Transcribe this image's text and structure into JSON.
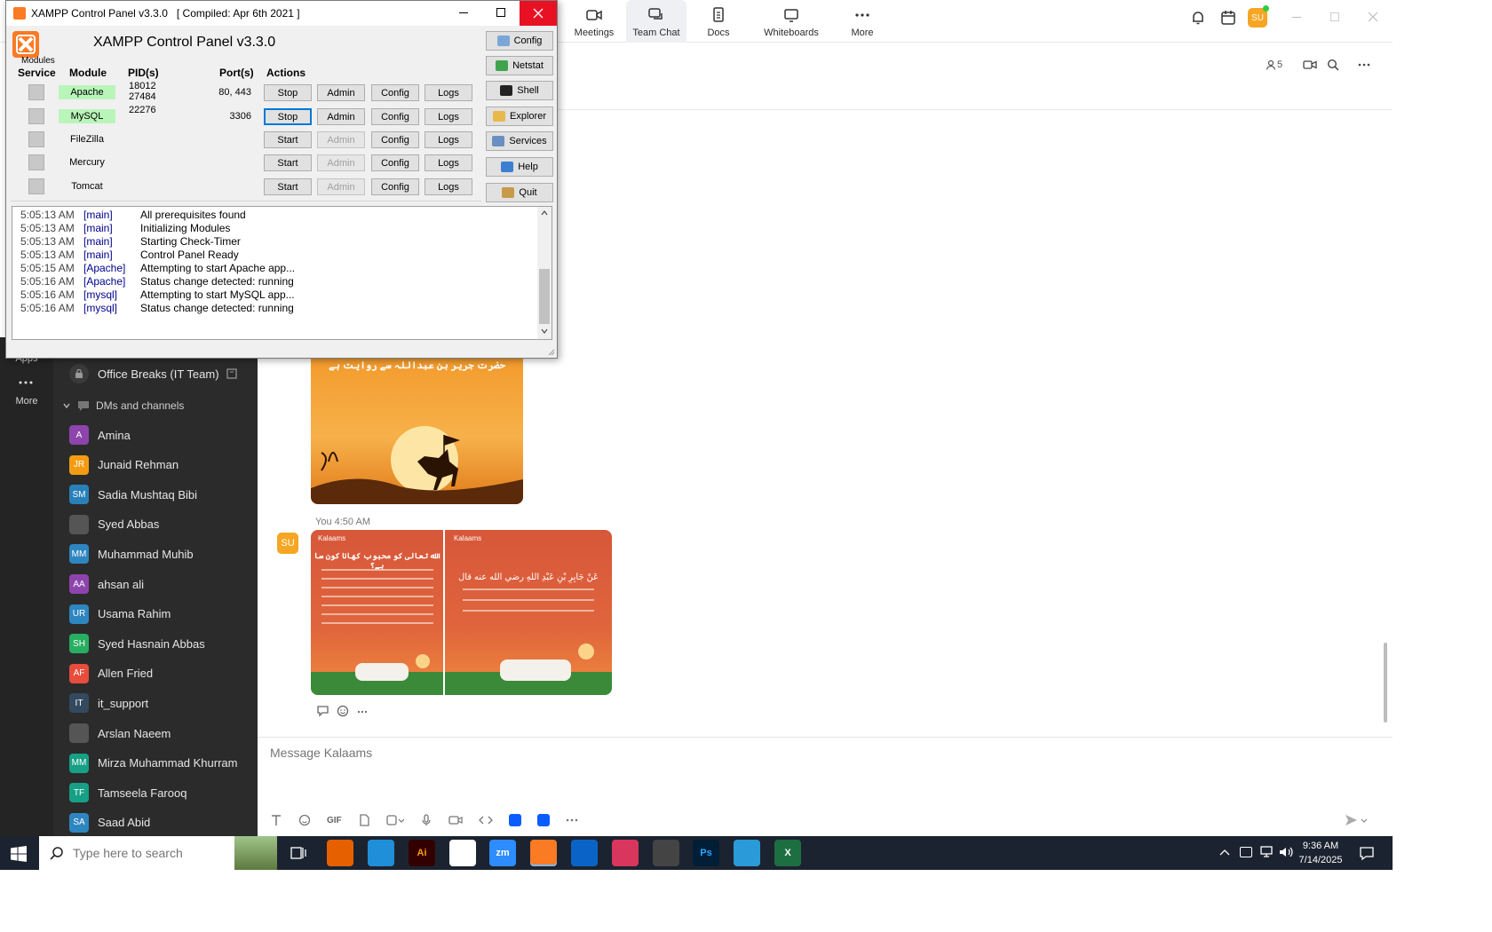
{
  "zoom": {
    "tabs": [
      {
        "label": "Meetings",
        "icon": "video-camera-icon"
      },
      {
        "label": "Team Chat",
        "icon": "chat-bubble-icon",
        "active": true
      },
      {
        "label": "Docs",
        "icon": "document-icon"
      },
      {
        "label": "Whiteboards",
        "icon": "whiteboard-icon"
      },
      {
        "label": "More",
        "icon": "more-dots-icon"
      }
    ],
    "user_initials": "SU",
    "header_member_count": "5",
    "rail": {
      "apps_label": "Apps",
      "more_label": "More"
    },
    "sidebar": {
      "channel_office": "Office Breaks (IT Team)",
      "section_dms": "DMs and channels",
      "contacts": [
        {
          "name": "Amina",
          "initials": "A",
          "color": "#8e44ad"
        },
        {
          "name": "Junaid Rehman",
          "initials": "JR",
          "color": "#f39c12"
        },
        {
          "name": "Sadia Mushtaq Bibi",
          "initials": "SM",
          "color": "#2980b9"
        },
        {
          "name": "Syed Abbas",
          "initials": "",
          "color": "#555"
        },
        {
          "name": "Muhammad Muhib",
          "initials": "MM",
          "color": "#2e86c1"
        },
        {
          "name": "ahsan ali",
          "initials": "AA",
          "color": "#8e44ad"
        },
        {
          "name": "Usama Rahim",
          "initials": "UR",
          "color": "#2e86c1"
        },
        {
          "name": "Syed Hasnain Abbas",
          "initials": "SH",
          "color": "#27ae60"
        },
        {
          "name": "Allen Fried",
          "initials": "AF",
          "color": "#e74c3c"
        },
        {
          "name": "it_support",
          "initials": "IT",
          "color": "#34495e"
        },
        {
          "name": "Arslan Naeem",
          "initials": "",
          "color": "#555"
        },
        {
          "name": "Mirza Muhammad Khurram",
          "initials": "MM",
          "color": "#16a085"
        },
        {
          "name": "Tamseela Farooq",
          "initials": "TF",
          "color": "#16a085"
        },
        {
          "name": "Saad Abid",
          "initials": "SA",
          "color": "#2e86c1"
        }
      ]
    },
    "chat": {
      "msg_meta": "You 4:50 AM",
      "sender_initials": "SU",
      "img1": {
        "logo": "Kalaams",
        "heading": "الله تعالى کو محبوب کھانا کون سا ہے؟"
      },
      "img2": {
        "logo": "Kalaams",
        "heading": "عَنْ جَابِرِ بْنِ عَبْدِ اللهِ رضي الله عنه قال"
      },
      "img_top": {
        "heading": "حضرت جریر بن عبداللہ سے روایت ہے"
      }
    },
    "compose": {
      "placeholder": "Message Kalaams",
      "gif_label": "GIF"
    }
  },
  "xampp": {
    "window_title": "XAMPP Control Panel v3.3.0   [ Compiled: Apr 6th 2021 ]",
    "heading": "XAMPP Control Panel v3.3.0",
    "modules_label": "Modules",
    "columns": {
      "service": "Service",
      "module": "Module",
      "pids": "PID(s)",
      "ports": "Port(s)",
      "actions": "Actions"
    },
    "rows": [
      {
        "module": "Apache",
        "running": true,
        "pid1": "18012",
        "pid2": "27484",
        "ports": "80, 443",
        "action": "Stop",
        "admin": "Admin",
        "config": "Config",
        "logs": "Logs"
      },
      {
        "module": "MySQL",
        "running": true,
        "pid1": "22276",
        "pid2": "",
        "ports": "3306",
        "action": "Stop",
        "admin": "Admin",
        "config": "Config",
        "logs": "Logs"
      },
      {
        "module": "FileZilla",
        "running": false,
        "pid1": "",
        "pid2": "",
        "ports": "",
        "action": "Start",
        "admin": "Admin",
        "config": "Config",
        "logs": "Logs"
      },
      {
        "module": "Mercury",
        "running": false,
        "pid1": "",
        "pid2": "",
        "ports": "",
        "action": "Start",
        "admin": "Admin",
        "config": "Config",
        "logs": "Logs"
      },
      {
        "module": "Tomcat",
        "running": false,
        "pid1": "",
        "pid2": "",
        "ports": "",
        "action": "Start",
        "admin": "Admin",
        "config": "Config",
        "logs": "Logs"
      }
    ],
    "side_buttons": [
      {
        "label": "Config",
        "color": "#7aa7d8"
      },
      {
        "label": "Netstat",
        "color": "#3fa34d"
      },
      {
        "label": "Shell",
        "color": "#222"
      },
      {
        "label": "Explorer",
        "color": "#e8b84a"
      },
      {
        "label": "Services",
        "color": "#6a8fc0"
      },
      {
        "label": "Help",
        "color": "#3c7fd0"
      },
      {
        "label": "Quit",
        "color": "#c79a4a"
      }
    ],
    "log": [
      {
        "time": "5:05:13 AM",
        "src": "[main]",
        "msg": "All prerequisites found"
      },
      {
        "time": "5:05:13 AM",
        "src": "[main]",
        "msg": "Initializing Modules"
      },
      {
        "time": "5:05:13 AM",
        "src": "[main]",
        "msg": "Starting Check-Timer"
      },
      {
        "time": "5:05:13 AM",
        "src": "[main]",
        "msg": "Control Panel Ready"
      },
      {
        "time": "5:05:15 AM",
        "src": "[Apache]",
        "msg": "Attempting to start Apache app..."
      },
      {
        "time": "5:05:16 AM",
        "src": "[Apache]",
        "msg": "Status change detected: running"
      },
      {
        "time": "5:05:16 AM",
        "src": "[mysql]",
        "msg": "Attempting to start MySQL app..."
      },
      {
        "time": "5:05:16 AM",
        "src": "[mysql]",
        "msg": "Status change detected: running"
      }
    ]
  },
  "taskbar": {
    "search_placeholder": "Type here to search",
    "time": "9:36 AM",
    "date": "7/14/2025",
    "apps": [
      "Firefox",
      "VS Code",
      "Ai",
      "Chrome",
      "zm",
      "XAMPP",
      "Outlook",
      "Creative Cloud",
      "Pen",
      "Ps",
      "Fluent",
      "Excel"
    ]
  }
}
